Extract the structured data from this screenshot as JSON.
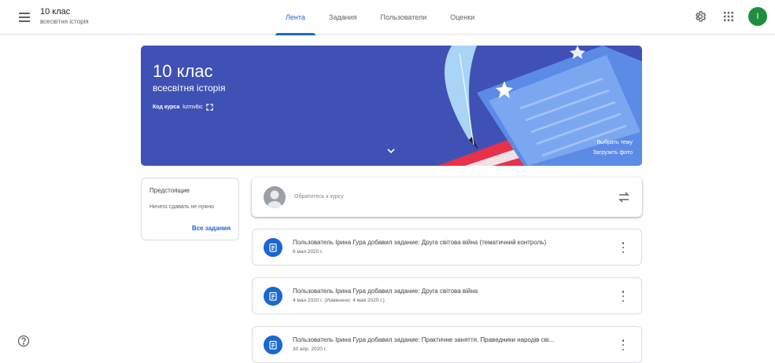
{
  "header": {
    "class_name": "10 клас",
    "class_subject": "всесвітня історія",
    "tabs": [
      {
        "label": "Лента",
        "active": true
      },
      {
        "label": "Задания",
        "active": false
      },
      {
        "label": "Пользователи",
        "active": false
      },
      {
        "label": "Оценки",
        "active": false
      }
    ],
    "avatar_letter": "I",
    "icons": [
      "menu-icon",
      "settings-icon",
      "apps-grid-icon"
    ]
  },
  "banner": {
    "title": "10 клас",
    "subtitle": "всесвітня історія",
    "code_label": "Код курса",
    "code_value": "kzmvibc",
    "select_theme": "Выбрать тему",
    "upload_photo": "Загрузить фото",
    "color": "#3f51b5"
  },
  "upcoming": {
    "title": "Предстоящие",
    "empty_text": "Ничего сдавать не нужно",
    "all_link": "Все задания"
  },
  "stream": {
    "placeholder": "Обратитесь к курсу",
    "posts": [
      {
        "title": "Пользователь Ірина Гура добавил задание: Друга світова війна (тематичний контроль)",
        "date": "6 мая 2020 г."
      },
      {
        "title": "Пользователь Ірина Гура добавил задание: Друга світова війна",
        "date": "4 мая 2020 г. (Изменено: 4 мая 2020 г.)"
      },
      {
        "title": "Пользователь Ірина Гура добавил задание: Практичне заняття. Праведники народів сві...",
        "date": "30 апр. 2020 г."
      }
    ]
  },
  "colors": {
    "accent": "#1967d2",
    "avatar": "#1e8e3e"
  }
}
